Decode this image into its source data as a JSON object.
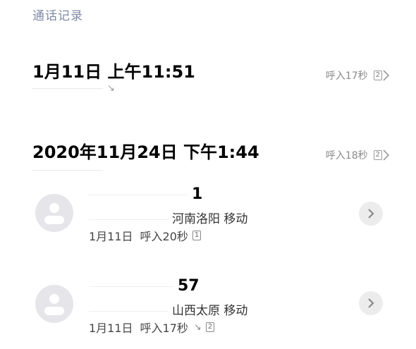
{
  "header": {
    "section_label": "通话记录"
  },
  "call_entries": [
    {
      "title": "1月11日 上午11:51",
      "direction_label": "呼入17秒",
      "count": "2"
    },
    {
      "title": "2020年11月24日 下午1:44",
      "direction_label": "呼入18秒",
      "count": "2"
    }
  ],
  "contacts": [
    {
      "number_visible": "1",
      "location": "河南洛阳 移动",
      "date": "1月11日",
      "call_info": "呼入20秒",
      "count": "1",
      "show_incoming_arrow": false
    },
    {
      "number_visible": "57",
      "location": "山西太原 移动",
      "date": "1月11日",
      "call_info": "呼入17秒",
      "count": "2",
      "show_incoming_arrow": true
    }
  ],
  "icons": {
    "avatar": "person-icon",
    "incoming_arrow": "incoming-call-arrow-icon",
    "chevron": "chevron-right-icon"
  },
  "colors": {
    "section_label": "#7f8aa6",
    "avatar_bg": "#e6e6ea",
    "detail_button_bg": "#ececec"
  }
}
